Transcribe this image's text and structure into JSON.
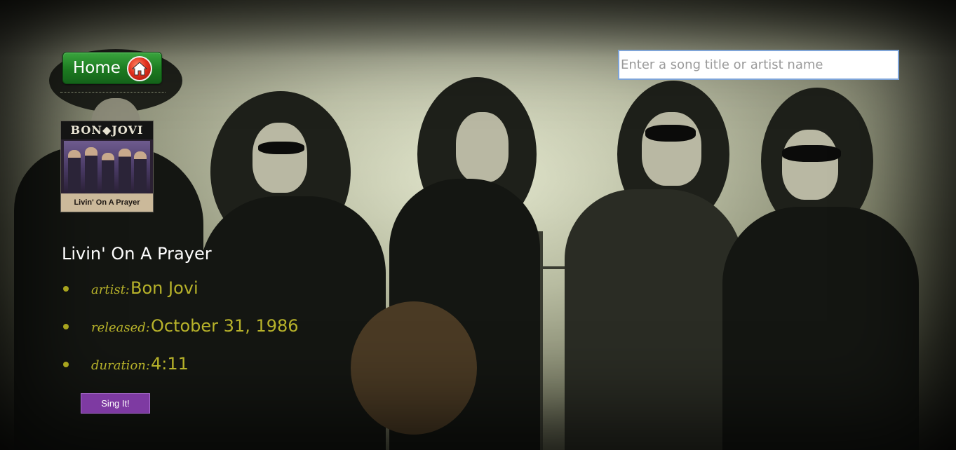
{
  "header": {
    "home_label": "Home",
    "home_icon": "home-icon"
  },
  "search": {
    "placeholder": "Enter a song title or artist name",
    "value": ""
  },
  "album": {
    "band_text": "BON◆JOVI",
    "cover_title": "Livin' On A Prayer"
  },
  "song": {
    "title": "Livin' On A Prayer",
    "details": [
      {
        "label": "artist:",
        "value": "Bon Jovi"
      },
      {
        "label": "released:",
        "value": "October 31, 1986"
      },
      {
        "label": "duration:",
        "value": "4:11"
      }
    ]
  },
  "actions": {
    "sing_label": "Sing It!"
  },
  "colors": {
    "home_button": "#1c7a20",
    "detail_text": "#b7b22a",
    "sing_button": "#7e3aa2",
    "search_border": "#7ea4d8"
  }
}
